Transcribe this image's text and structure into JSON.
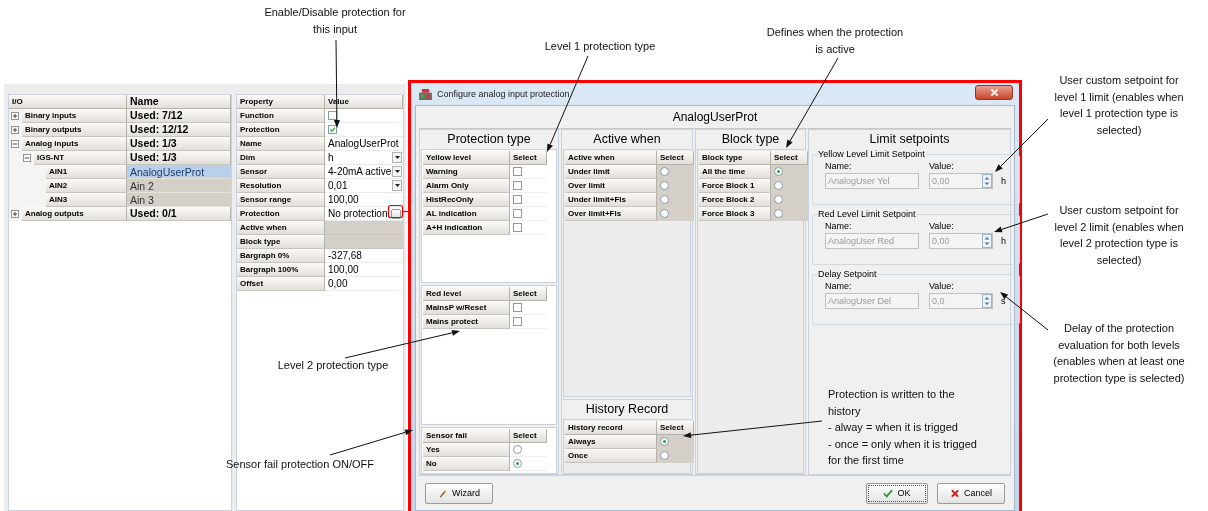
{
  "editor": {
    "io_table": {
      "columns": [
        "I/O",
        "Name"
      ],
      "items": [
        {
          "label": "Binary inputs",
          "value": "Used: 7/12",
          "expanded": false
        },
        {
          "label": "Binary outputs",
          "value": "Used: 12/12",
          "expanded": false
        },
        {
          "label": "Analog inputs",
          "value": "Used: 1/3",
          "expanded": true,
          "children": [
            {
              "label": "IGS-NT",
              "value": "Used: 1/3",
              "expanded": true,
              "children": [
                {
                  "label": "AIN1",
                  "value": "AnalogUserProt",
                  "selected": true
                },
                {
                  "label": "AIN2",
                  "value": "Ain 2",
                  "selected": false
                },
                {
                  "label": "AIN3",
                  "value": "Ain 3",
                  "selected": false
                }
              ]
            }
          ]
        },
        {
          "label": "Analog outputs",
          "value": "Used: 0/1",
          "expanded": false
        }
      ]
    },
    "property_table": {
      "columns": [
        "Property",
        "Value"
      ],
      "rows": [
        {
          "kind": "check",
          "label": "Function",
          "checked": false
        },
        {
          "kind": "check",
          "label": "Protection",
          "checked": true
        },
        {
          "kind": "text",
          "label": "Name",
          "value": "AnalogUserProt"
        },
        {
          "kind": "select",
          "label": "Dim",
          "value": "h"
        },
        {
          "kind": "select",
          "label": "Sensor",
          "value": "4-20mA active"
        },
        {
          "kind": "select",
          "label": "Resolution",
          "value": "0,01"
        },
        {
          "kind": "text",
          "label": "Sensor range",
          "value": "100,00"
        },
        {
          "kind": "button",
          "label": "Protection",
          "value": "No protection"
        },
        {
          "kind": "empty",
          "label": "Active when"
        },
        {
          "kind": "empty",
          "label": "Block type"
        },
        {
          "kind": "text",
          "label": "Bargraph 0%",
          "value": "-327,68"
        },
        {
          "kind": "text",
          "label": "Bargraph 100%",
          "value": "100,00"
        },
        {
          "kind": "text",
          "label": "Offset",
          "value": "0,00"
        }
      ]
    }
  },
  "dialog": {
    "title": "Configure analog input protection",
    "heading": "AnalogUserProt",
    "protection_type": {
      "title": "Protection type",
      "tables": [
        {
          "kind": "checkbox",
          "columns": [
            "Yellow level",
            "Select"
          ],
          "rows": [
            {
              "label": "Warning",
              "checked": false
            },
            {
              "label": "Alarm Only",
              "checked": false
            },
            {
              "label": "HistRecOnly",
              "checked": false
            },
            {
              "label": "AL indication",
              "checked": false
            },
            {
              "label": "A+H indication",
              "checked": false
            }
          ]
        },
        {
          "kind": "checkbox",
          "columns": [
            "Red level",
            "Select"
          ],
          "rows": [
            {
              "label": "MainsP w/Reset",
              "checked": false
            },
            {
              "label": "Mains protect",
              "checked": false
            }
          ]
        },
        {
          "kind": "radio",
          "columns": [
            "Sensor fail",
            "Select"
          ],
          "rows": [
            {
              "label": "Yes",
              "selected": false
            },
            {
              "label": "No",
              "selected": true
            }
          ]
        }
      ]
    },
    "active_when": {
      "title": "Active when",
      "table": {
        "kind": "radio",
        "columns": [
          "Active when",
          "Select"
        ],
        "rows": [
          {
            "label": "Under limit",
            "selected": false
          },
          {
            "label": "Over limit",
            "selected": false
          },
          {
            "label": "Under limit+Fls",
            "selected": false
          },
          {
            "label": "Over limit+Fls",
            "selected": false
          }
        ]
      }
    },
    "history_record": {
      "title": "History Record",
      "table": {
        "kind": "radio",
        "columns": [
          "History record",
          "Select"
        ],
        "rows": [
          {
            "label": "Always",
            "selected": true
          },
          {
            "label": "Once",
            "selected": false
          }
        ]
      }
    },
    "block_type": {
      "title": "Block type",
      "table": {
        "kind": "radio",
        "columns": [
          "Block type",
          "Select"
        ],
        "rows": [
          {
            "label": "All the time",
            "selected": true
          },
          {
            "label": "Force Block 1",
            "selected": false
          },
          {
            "label": "Force Block 2",
            "selected": false
          },
          {
            "label": "Force Block 3",
            "selected": false
          }
        ]
      }
    },
    "limit_setpoints": {
      "title": "Limit setpoints",
      "groups": [
        {
          "title": "Yellow Level Limit Setpoint",
          "name_label": "Name:",
          "name": "AnalogUser Yel",
          "value_label": "Value:",
          "value": "0,00",
          "unit": "h",
          "disabled": true
        },
        {
          "title": "Red Level Limit Setpoint",
          "name_label": "Name:",
          "name": "AnalogUser Red",
          "value_label": "Value:",
          "value": "0,00",
          "unit": "h",
          "disabled": true
        },
        {
          "title": "Delay Setpoint",
          "name_label": "Name:",
          "name": "AnalogUser Del",
          "value_label": "Value:",
          "value": "0,0",
          "unit": "s",
          "disabled": true
        }
      ]
    },
    "buttons": {
      "wizard": "Wizard",
      "ok": "OK",
      "cancel": "Cancel"
    }
  },
  "annotations": [
    {
      "lines": [
        "Enable/Disable protection for",
        "this input"
      ]
    },
    {
      "lines": [
        "Level 1 protection type"
      ]
    },
    {
      "lines": [
        "Defines when the protection",
        "is active"
      ]
    },
    {
      "lines": [
        "User custom setpoint for",
        "level 1 limit (enables when",
        "level 1 protection type is",
        "selected)"
      ]
    },
    {
      "lines": [
        "User custom setpoint for",
        "level 2 limit (enables when",
        "level 2 protection type is",
        "selected)"
      ]
    },
    {
      "lines": [
        "Delay of the protection",
        "evaluation for both levels",
        "(enables when at least one",
        "protection type is selected)"
      ]
    },
    {
      "lines": [
        "Level 2 protection type"
      ]
    },
    {
      "lines": [
        "Sensor fail protection ON/OFF"
      ]
    },
    {
      "lines": [
        "Protection is written to the",
        "history",
        "- alway = when it is trigged",
        "- once = only when it is trigged",
        "for the first time"
      ]
    }
  ]
}
